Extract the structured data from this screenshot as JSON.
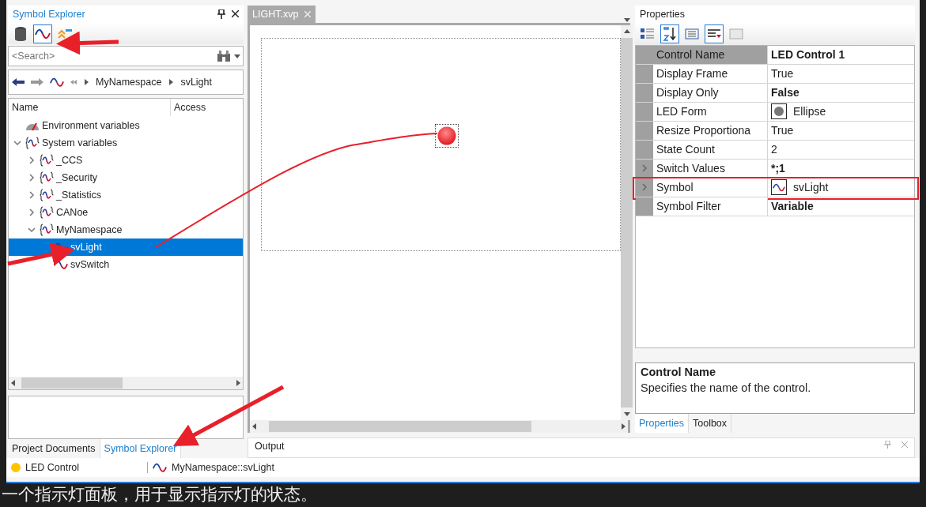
{
  "symbol_explorer": {
    "title": "Symbol Explorer",
    "search": {
      "placeholder": "<Search>"
    },
    "breadcrumb": [
      "MyNamespace",
      "svLight"
    ],
    "columns": [
      "Name",
      "Access"
    ],
    "tree": [
      {
        "label": "Environment variables",
        "kind": "environment",
        "selected": false
      },
      {
        "label": "System variables",
        "kind": "namespace",
        "expanded": true,
        "selected": false,
        "children": [
          {
            "label": "_CCS",
            "kind": "namespace",
            "expanded": false,
            "selected": false
          },
          {
            "label": "_Security",
            "kind": "namespace",
            "expanded": false,
            "selected": false
          },
          {
            "label": "_Statistics",
            "kind": "namespace",
            "expanded": false,
            "selected": false
          },
          {
            "label": "CANoe",
            "kind": "namespace",
            "expanded": false,
            "selected": false
          },
          {
            "label": "MyNamespace",
            "kind": "namespace",
            "expanded": true,
            "selected": false,
            "children": [
              {
                "label": "svLight",
                "kind": "variable",
                "selected": true
              },
              {
                "label": "svSwitch",
                "kind": "variable",
                "selected": false
              }
            ]
          }
        ]
      }
    ]
  },
  "left_tabs": [
    {
      "label": "Project Documents",
      "selected": false
    },
    {
      "label": "Symbol Explorer",
      "selected": true
    }
  ],
  "document": {
    "tab": "LIGHT.xvp"
  },
  "properties": {
    "title": "Properties",
    "rows": [
      {
        "name": "Control Name",
        "value": "LED Control 1",
        "kind": "text",
        "bold": true,
        "selected": true,
        "expandable": false,
        "highlighted": false
      },
      {
        "name": "Display Frame",
        "value": "True",
        "kind": "text",
        "bold": false,
        "selected": false,
        "expandable": false,
        "highlighted": false
      },
      {
        "name": "Display Only",
        "value": "False",
        "kind": "text",
        "bold": true,
        "selected": false,
        "expandable": false,
        "highlighted": false
      },
      {
        "name": "LED Form",
        "value": "Ellipse",
        "kind": "shape",
        "bold": false,
        "selected": false,
        "expandable": false,
        "highlighted": false
      },
      {
        "name": "Resize Proportiona",
        "value": "True",
        "kind": "text",
        "bold": false,
        "selected": false,
        "expandable": false,
        "highlighted": false
      },
      {
        "name": "State Count",
        "value": "2",
        "kind": "text",
        "bold": false,
        "selected": false,
        "expandable": false,
        "highlighted": false
      },
      {
        "name": "Switch Values",
        "value": "*;1",
        "kind": "text",
        "bold": true,
        "selected": false,
        "expandable": true,
        "highlighted": false
      },
      {
        "name": "Symbol",
        "value": "svLight",
        "kind": "symbol",
        "bold": false,
        "selected": false,
        "expandable": true,
        "highlighted": true
      },
      {
        "name": "Symbol Filter",
        "value": "Variable",
        "kind": "text",
        "bold": true,
        "selected": false,
        "expandable": false,
        "highlighted": false
      }
    ],
    "description": {
      "title": "Control Name",
      "text": "Specifies the name of the control."
    },
    "tabs": [
      {
        "label": "Properties",
        "selected": true
      },
      {
        "label": "Toolbox",
        "selected": false
      }
    ]
  },
  "output": {
    "title": "Output"
  },
  "status_bar": {
    "control": "LED Control",
    "symbol": "MyNamespace::svLight"
  },
  "caption": "一个指示灯面板，用于显示指示灯的状态。"
}
